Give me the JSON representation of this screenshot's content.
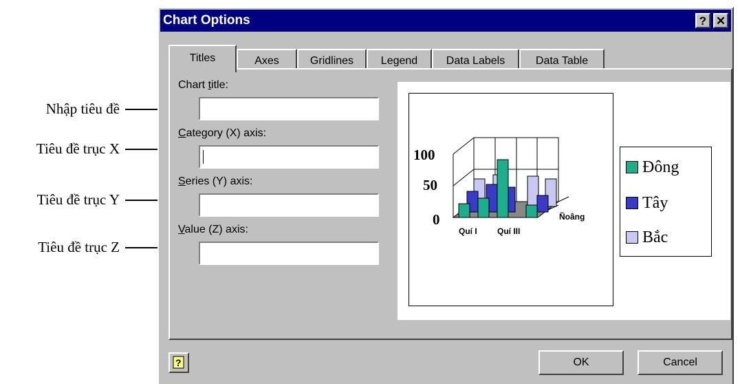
{
  "annotations": {
    "title": "Nhập tiêu đề",
    "x_axis": "Tiêu đề trục X",
    "y_axis": "Tiêu đề trục Y",
    "z_axis": "Tiêu đề trục Z"
  },
  "dialog": {
    "title": "Chart Options",
    "help_glyph": "?",
    "close_glyph": "✕"
  },
  "tabs": [
    "Titles",
    "Axes",
    "Gridlines",
    "Legend",
    "Data Labels",
    "Data Table"
  ],
  "fields": {
    "chart_title": {
      "pre": "Chart ",
      "u": "t",
      "post": "itle:",
      "value": ""
    },
    "category_axis": {
      "pre": "",
      "u": "C",
      "post": "ategory (X) axis:",
      "value": ""
    },
    "series_axis": {
      "pre": "",
      "u": "S",
      "post": "eries (Y) axis:",
      "value": ""
    },
    "value_axis": {
      "pre": "",
      "u": "V",
      "post": "alue (Z) axis:",
      "value": ""
    }
  },
  "preview": {
    "z_ticks": [
      "100",
      "50",
      "0"
    ],
    "categories": [
      "Quí I",
      "Quí III"
    ],
    "depth_label": "Ñoâng",
    "legend": [
      {
        "name": "Đông",
        "color": "#1fae8c"
      },
      {
        "name": "Tây",
        "color": "#3a3ac8"
      },
      {
        "name": "Bắc",
        "color": "#c8c8f0"
      }
    ]
  },
  "buttons": {
    "ok": "OK",
    "cancel": "Cancel"
  }
}
